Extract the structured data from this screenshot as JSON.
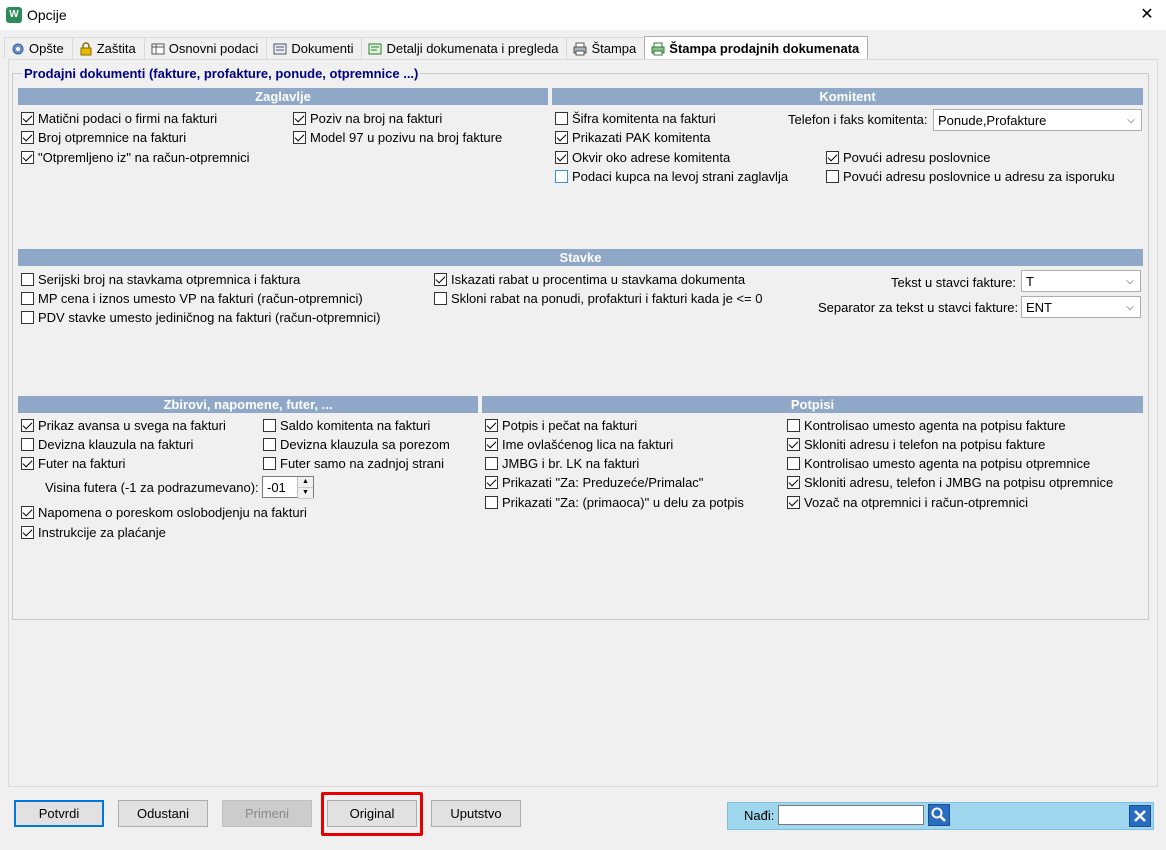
{
  "window": {
    "title": "Opcije",
    "close_glyph": "✕"
  },
  "tabs": [
    {
      "label": "Opšte",
      "icon": "gear-icon"
    },
    {
      "label": "Zaštita",
      "icon": "lock-icon"
    },
    {
      "label": "Osnovni podaci",
      "icon": "table-icon"
    },
    {
      "label": "Dokumenti",
      "icon": "document-icon"
    },
    {
      "label": "Detalji dokumenata i pregleda",
      "icon": "details-icon"
    },
    {
      "label": "Štampa",
      "icon": "printer-icon"
    },
    {
      "label": "Štampa prodajnih dokumenata",
      "icon": "printer-icon",
      "active": true
    }
  ],
  "group_title": "Prodajni dokumenti (fakture, profakture, ponude, otpremnice ...)",
  "zaglavlje": {
    "title": "Zaglavlje",
    "items": [
      {
        "label": "Matični podaci o firmi na fakturi",
        "checked": true
      },
      {
        "label": "Broj otpremnice na fakturi",
        "checked": true
      },
      {
        "label": "\"Otpremljeno iz\" na račun-otpremnici",
        "checked": true
      },
      {
        "label": "Poziv na broj na fakturi",
        "checked": true
      },
      {
        "label": "Model 97 u pozivu na broj fakture",
        "checked": true
      }
    ]
  },
  "komitent": {
    "title": "Komitent",
    "items": [
      {
        "label": "Šifra komitenta na fakturi",
        "checked": false
      },
      {
        "label": "Prikazati PAK komitenta",
        "checked": true
      },
      {
        "label": "Okvir oko adrese komitenta",
        "checked": true
      },
      {
        "label": "Podaci kupca na levoj strani zaglavlja",
        "checked": false
      },
      {
        "label": "Povući adresu poslovnice",
        "checked": true
      },
      {
        "label": "Povući adresu poslovnice u adresu za isporuku",
        "checked": false
      }
    ],
    "phone_label": "Telefon i faks komitenta:",
    "phone_value": "Ponude,Profakture"
  },
  "stavke": {
    "title": "Stavke",
    "items": [
      {
        "label": "Serijski broj na stavkama otpremnica i faktura",
        "checked": false
      },
      {
        "label": "MP cena i iznos umesto VP na fakturi (račun-otpremnici)",
        "checked": false
      },
      {
        "label": "PDV stavke umesto jediničnog na fakturi (račun-otpremnici)",
        "checked": false
      },
      {
        "label": "Iskazati rabat u procentima u stavkama dokumenta",
        "checked": true
      },
      {
        "label": "Skloni rabat na ponudi, profakturi i fakturi kada je <= 0",
        "checked": false
      }
    ],
    "text_label": "Tekst u stavci fakture:",
    "text_value": "T",
    "sep_label": "Separator za tekst u stavci fakture:",
    "sep_value": "ENT"
  },
  "zbirovi": {
    "title": "Zbirovi, napomene, futer, ...",
    "items": [
      {
        "label": "Prikaz avansa u svega na fakturi",
        "checked": true
      },
      {
        "label": "Devizna klauzula na fakturi",
        "checked": false
      },
      {
        "label": "Futer na fakturi",
        "checked": true
      },
      {
        "label": "Saldo komitenta na fakturi",
        "checked": false
      },
      {
        "label": "Devizna klauzula sa porezom",
        "checked": false
      },
      {
        "label": "Futer samo na zadnjoj strani",
        "checked": false
      },
      {
        "label": "Napomena o poreskom oslobodjenju na fakturi",
        "checked": true
      },
      {
        "label": "Instrukcije za plaćanje",
        "checked": true
      }
    ],
    "footer_height_label": "Visina futera (-1 za podrazumevano):",
    "footer_height_value": "-01"
  },
  "potpisi": {
    "title": "Potpisi",
    "items": [
      {
        "label": "Potpis i pečat na fakturi",
        "checked": true
      },
      {
        "label": "Ime ovlašćenog lica na fakturi",
        "checked": true
      },
      {
        "label": "JMBG i br. LK na fakturi",
        "checked": false
      },
      {
        "label": "Prikazati \"Za: Preduzeće/Primalac\"",
        "checked": true
      },
      {
        "label": "Prikazati \"Za: (primaoca)\" u delu za potpis",
        "checked": false
      },
      {
        "label": "Kontrolisao umesto agenta na potpisu fakture",
        "checked": false
      },
      {
        "label": "Skloniti adresu i telefon na potpisu fakture",
        "checked": true
      },
      {
        "label": "Kontrolisao umesto agenta na potpisu otpremnice",
        "checked": false
      },
      {
        "label": "Skloniti adresu, telefon i JMBG na potpisu otpremnice",
        "checked": true
      },
      {
        "label": "Vozač na otpremnici i račun-otpremnici",
        "checked": true
      }
    ]
  },
  "buttons": {
    "confirm": "Potvrdi",
    "cancel": "Odustani",
    "apply": "Primeni",
    "original": "Original",
    "help": "Uputstvo"
  },
  "find": {
    "label": "Nađi:",
    "value": ""
  },
  "colors": {
    "section_header": "#8fa8c8",
    "group_title": "#000080",
    "find_bar": "#9fd7ef",
    "highlight": "#e60000"
  }
}
